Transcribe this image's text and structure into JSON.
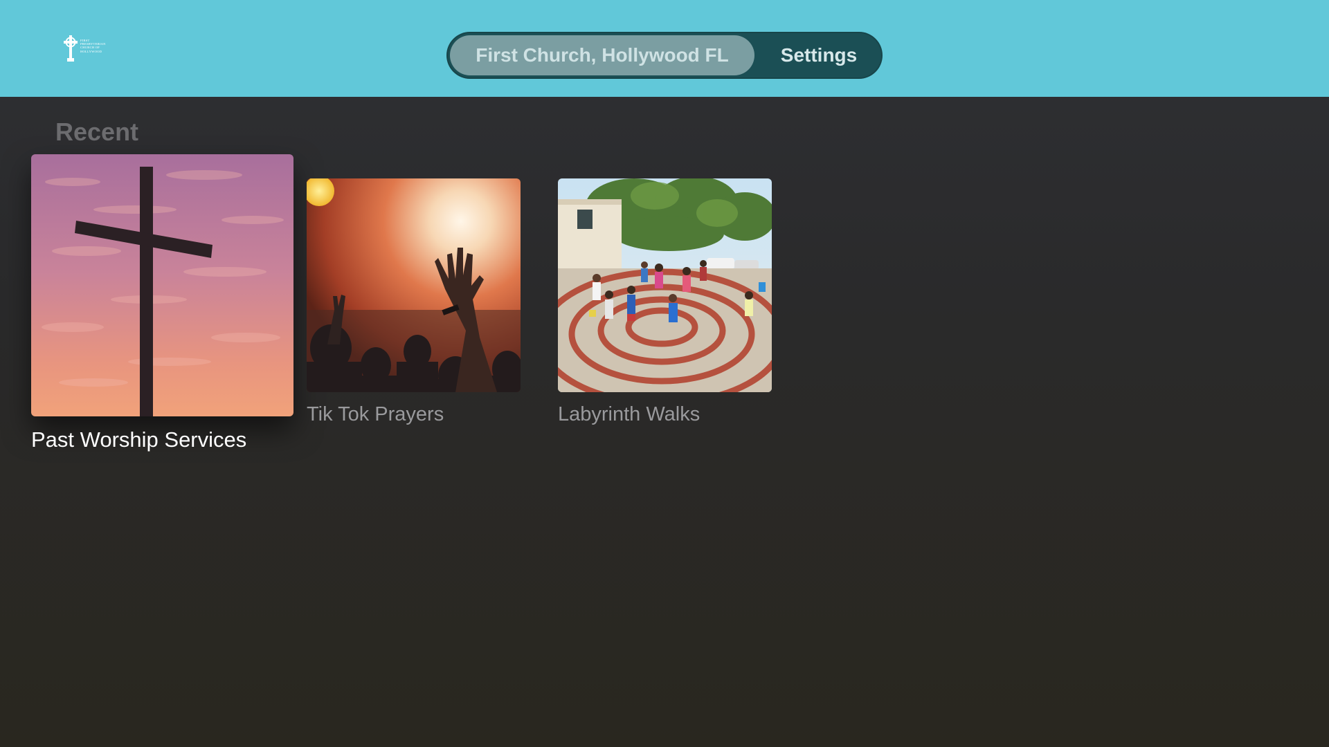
{
  "colors": {
    "header_bg": "#61c8d9",
    "tabbar_bg": "#1b4f55",
    "tab_selected_bg": "#7b9ea2",
    "page_bg": "#2c2c2d"
  },
  "header": {
    "logo": {
      "icon": "celtic-cross-logo",
      "lines": [
        "FIRST",
        "PRESBYTERIAN",
        "CHURCH OF",
        "HOLLYWOOD"
      ]
    },
    "tabs": [
      {
        "label": "First Church, Hollywood FL",
        "selected": true
      },
      {
        "label": "Settings",
        "selected": false
      }
    ]
  },
  "main": {
    "section_title": "Recent",
    "items": [
      {
        "title": "Past Worship Services",
        "image": "cross-sunset-image",
        "focused": true
      },
      {
        "title": "Tik Tok Prayers",
        "image": "worship-concert-image",
        "focused": false
      },
      {
        "title": "Labyrinth Walks",
        "image": "children-labyrinth-image",
        "focused": false
      }
    ]
  }
}
